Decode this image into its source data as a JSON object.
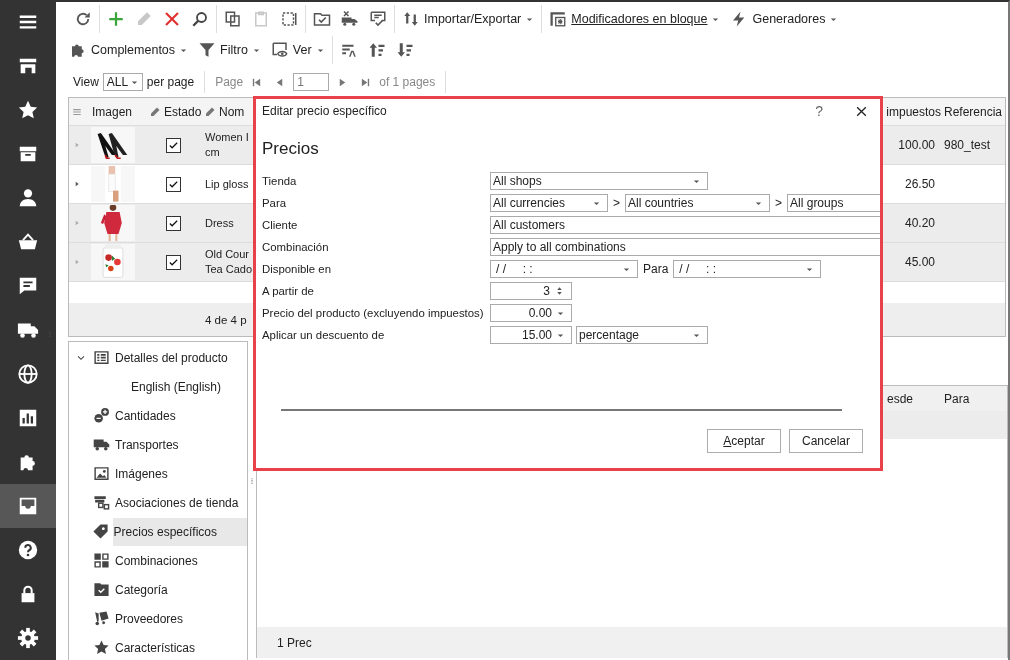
{
  "rail": [
    {
      "selected": false
    },
    {
      "selected": false
    },
    {
      "selected": false
    },
    {
      "selected": false
    },
    {
      "selected": false
    },
    {
      "selected": false
    },
    {
      "selected": false
    },
    {
      "selected": false
    },
    {
      "selected": false
    },
    {
      "selected": false
    },
    {
      "selected": false
    },
    {
      "selected": true
    },
    {
      "selected": false
    },
    {
      "selected": false
    },
    {
      "selected": false
    }
  ],
  "toolbar": {
    "icon_buttons": [
      {
        "disabled": false
      },
      {
        "disabled": false
      },
      {
        "disabled": true
      },
      {
        "disabled": false
      },
      {
        "disabled": false
      },
      {
        "disabled": false
      },
      {
        "disabled": true
      },
      {
        "disabled": false
      },
      {
        "disabled": false
      },
      {
        "disabled": false
      },
      {
        "disabled": false
      }
    ],
    "menus": [
      {
        "label": "Importar/Exportar"
      },
      {
        "label": "Modificadores en bloque"
      },
      {
        "label": "Generadores"
      }
    ],
    "menus_2": [
      {
        "label": "Complementos"
      },
      {
        "label": "Filtro"
      },
      {
        "label": "Ver"
      }
    ]
  },
  "pager": {
    "view_label": "View",
    "page_size": "ALL",
    "per_page_label": "per page",
    "page_label": "Page",
    "page": "1",
    "total": "of 1 pages"
  },
  "grid": {
    "columns": [
      {
        "label": "Imagen",
        "editable": false
      },
      {
        "label": "Estado",
        "editable": true
      },
      {
        "label": "Nom",
        "editable": true
      },
      {
        "label": "impuestos",
        "editable": false
      },
      {
        "label": "Referencia",
        "editable": false
      }
    ],
    "rows": [
      {
        "selected": false,
        "image": {
          "kind": "picture"
        },
        "checked": true,
        "name": [
          "Women I",
          "cm"
        ],
        "price": "100.00",
        "reference": "980_test"
      },
      {
        "selected": true,
        "image": {
          "kind": "picture"
        },
        "checked": true,
        "name": [
          "Lip gloss"
        ],
        "price": "26.50"
      },
      {
        "selected": false,
        "image": {
          "kind": "picture"
        },
        "checked": true,
        "name": [
          "Dress"
        ],
        "price": "40.20"
      },
      {
        "selected": false,
        "image": {
          "kind": "picture"
        },
        "checked": true,
        "name": [
          "Old Cour",
          "Tea Cado"
        ],
        "price": "45.00"
      }
    ],
    "footer": "4 de 4 p"
  },
  "tree": [
    {
      "label": "Detalles del producto",
      "expanded": true,
      "selected": false,
      "children": [
        {
          "label": "English (English)",
          "selected": false
        }
      ]
    },
    {
      "label": "Cantidades",
      "selected": false
    },
    {
      "label": "Transportes",
      "selected": false
    },
    {
      "label": "Imágenes",
      "selected": false
    },
    {
      "label": "Asociaciones de tienda",
      "selected": false
    },
    {
      "label": "Precios específicos",
      "selected": true
    },
    {
      "label": "Combinaciones",
      "selected": false
    },
    {
      "label": "Categoría",
      "selected": false
    },
    {
      "label": "Proveedores",
      "selected": false
    },
    {
      "label": "Características",
      "selected": false
    }
  ],
  "detail_grid": {
    "columns": [
      "esde",
      "Para"
    ],
    "footer": "1 Prec"
  },
  "dialog": {
    "title": "Editar precio específico",
    "help": "?",
    "heading": "Precios",
    "fields": [
      {
        "label": "Tienda",
        "kind": "select",
        "value": "All shops"
      },
      {
        "label": "Para",
        "kind": "chain",
        "parts": [
          {
            "value": "All currencies",
            "dropdown": true
          },
          {
            "prefix": ">",
            "value": "All countries",
            "dropdown": true
          },
          {
            "prefix": ">",
            "value": "All groups",
            "dropdown": false
          }
        ]
      },
      {
        "label": "Cliente",
        "kind": "text",
        "value": "All customers"
      },
      {
        "label": "Combinación",
        "kind": "text",
        "value": "Apply to all combinations"
      },
      {
        "label": "Disponible en",
        "kind": "range",
        "from": "/ /     : :",
        "separator": "Para",
        "to": "/ /     : :"
      },
      {
        "label": "A partir de",
        "kind": "spin",
        "value": "3"
      },
      {
        "label": "Precio del producto (excluyendo impuestos)",
        "kind": "number_select",
        "value": "0.00"
      },
      {
        "label": "Aplicar un descuento de",
        "kind": "number_select",
        "value": "15.00",
        "unit": "percentage"
      }
    ],
    "buttons": [
      {
        "label": "Aceptar"
      },
      {
        "label": "Cancelar"
      }
    ]
  }
}
